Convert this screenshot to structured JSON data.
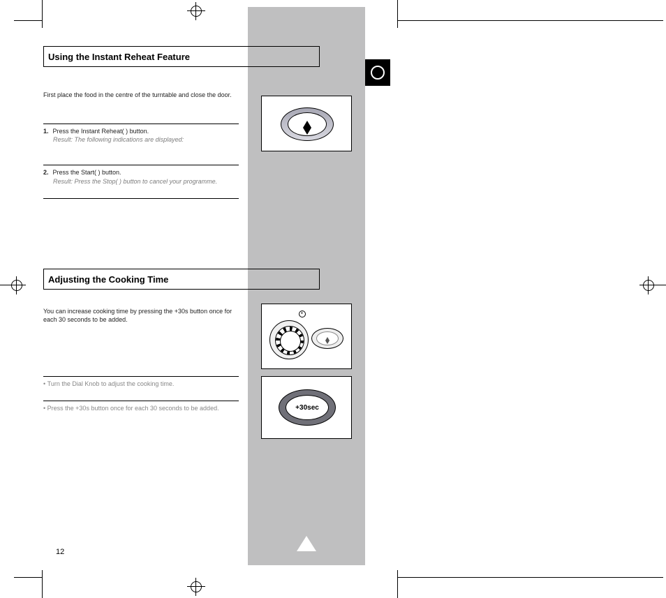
{
  "page_number": "12",
  "tab": {
    "label_icon": "language-ring"
  },
  "section1": {
    "title": "Using the Instant Reheat Feature",
    "intro": "First place the food in the centre of the turntable and close the door.",
    "steps": [
      {
        "n": "1.",
        "text": "Press the Instant Reheat(    ) button.",
        "result": "Result:    The following indications are displayed:"
      },
      {
        "n": "2.",
        "text": "Press the Start(    ) button.",
        "result": "Result:    Press the Stop(    ) button to cancel your programme."
      }
    ]
  },
  "section2": {
    "title": "Adjusting the Cooking Time",
    "intro": "You can increase cooking time by pressing the +30s button once for each 30 seconds to be added.",
    "items": [
      "Turn the Dial Knob to adjust the cooking time.",
      "Press the +30s button once for each 30 seconds to be added."
    ]
  },
  "fig3_label": "+30sec"
}
